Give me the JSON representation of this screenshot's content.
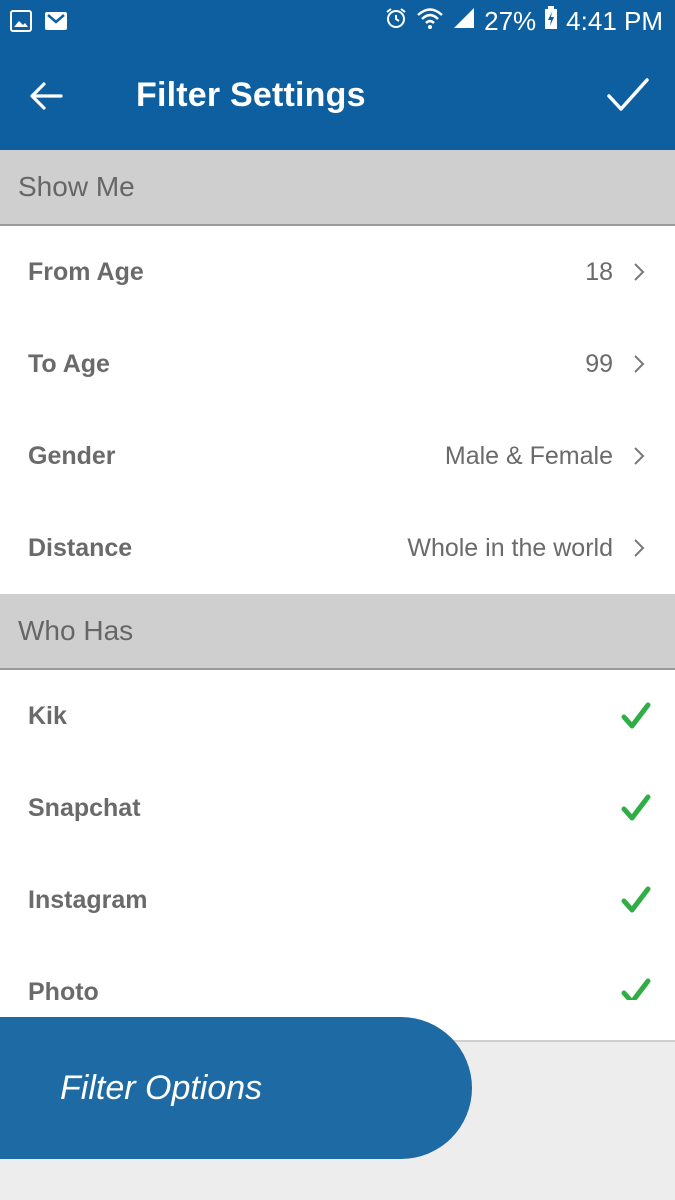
{
  "status_bar": {
    "battery": "27%",
    "time": "4:41 PM",
    "icons": [
      "gallery-icon",
      "gmail-icon",
      "alarm-icon",
      "wifi-icon",
      "signal-icon",
      "battery-icon"
    ]
  },
  "app_bar": {
    "title": "Filter Settings",
    "back_icon": "arrow-left-icon",
    "confirm_icon": "check-icon",
    "color": "#0e5f9f"
  },
  "show_me": {
    "header": "Show Me",
    "rows": [
      {
        "label": "From Age",
        "value": "18"
      },
      {
        "label": "To Age",
        "value": "99"
      },
      {
        "label": "Gender",
        "value": "Male & Female"
      },
      {
        "label": "Distance",
        "value": "Whole in the world"
      }
    ]
  },
  "who_has": {
    "header": "Who Has",
    "check_color": "#2fae45",
    "rows": [
      {
        "label": "Kik",
        "checked": true
      },
      {
        "label": "Snapchat",
        "checked": true
      },
      {
        "label": "Instagram",
        "checked": true
      },
      {
        "label": "Photo",
        "checked": true
      }
    ]
  },
  "filter_options": {
    "label": "Filter Options",
    "color": "#1e6aa4"
  }
}
